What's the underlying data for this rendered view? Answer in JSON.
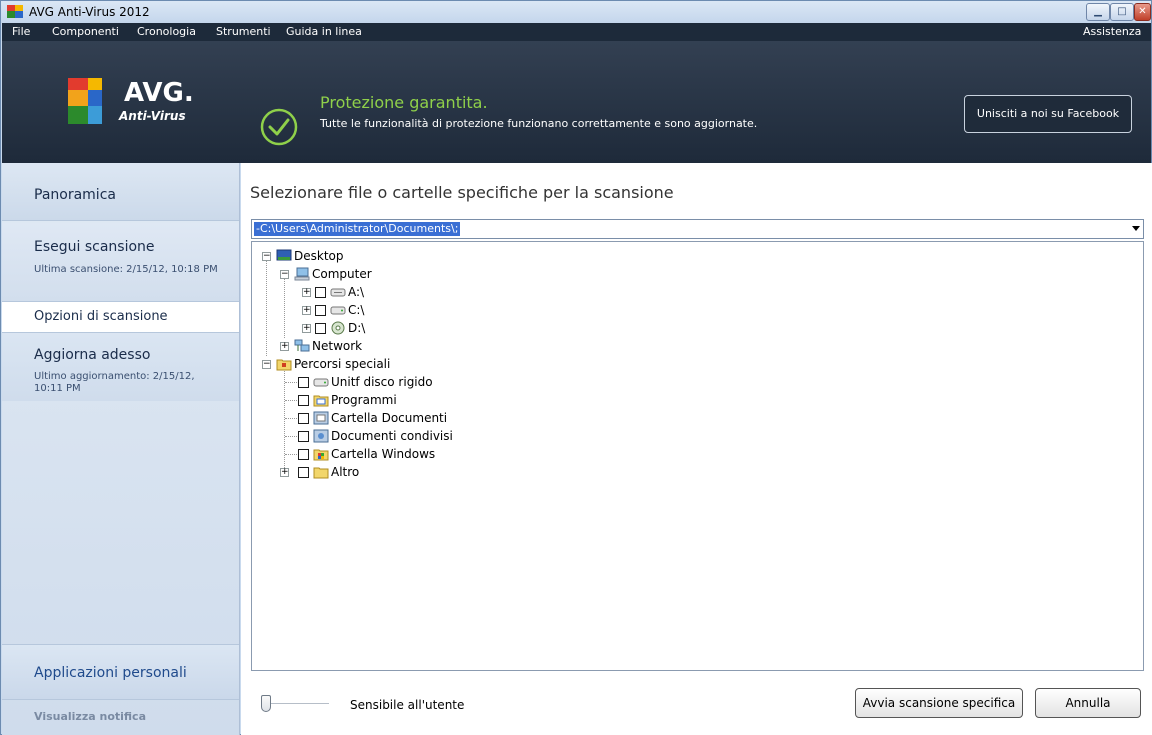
{
  "window": {
    "title": "AVG Anti-Virus 2012"
  },
  "menu": {
    "file": "File",
    "componenti": "Componenti",
    "cronologia": "Cronologia",
    "strumenti": "Strumenti",
    "guida": "Guida in linea",
    "assistenza": "Assistenza"
  },
  "header": {
    "logo_text": "AVG.",
    "logo_sub": "Anti-Virus",
    "status_title": "Protezione garantita.",
    "status_desc": "Tutte le funzionalità di protezione funzionano correttamente e sono aggiornate.",
    "facebook_button": "Unisciti a noi su Facebook",
    "status_color": "#8fd04a"
  },
  "sidebar": {
    "panoramica": "Panoramica",
    "esegui_title": "Esegui scansione",
    "esegui_sub": "Ultima scansione: 2/15/12, 10:18 PM",
    "opzioni": "Opzioni di scansione",
    "aggiorna_title": "Aggiorna adesso",
    "aggiorna_sub": "Ultimo aggiornamento: 2/15/12, 10:11 PM",
    "apps": "Applicazioni personali",
    "notifica": "Visualizza notifica"
  },
  "main": {
    "title": "Selezionare file o cartelle specifiche per la scansione",
    "path": "-C:\\Users\\Administrator\\Documents\\;",
    "tree": {
      "desktop": "Desktop",
      "computer": "Computer",
      "drive_a": "A:\\",
      "drive_c": "C:\\",
      "drive_d": "D:\\",
      "network": "Network",
      "percorsi": "Percorsi speciali",
      "unita": "Unitf disco rigido",
      "programmi": "Programmi",
      "cartella_documenti": "Cartella Documenti",
      "documenti_condivisi": "Documenti condivisi",
      "cartella_windows": "Cartella Windows",
      "altro": "Altro"
    },
    "slider_label": "Sensibile all'utente",
    "avvia_button": "Avvia scansione specifica",
    "annulla_button": "Annulla"
  }
}
